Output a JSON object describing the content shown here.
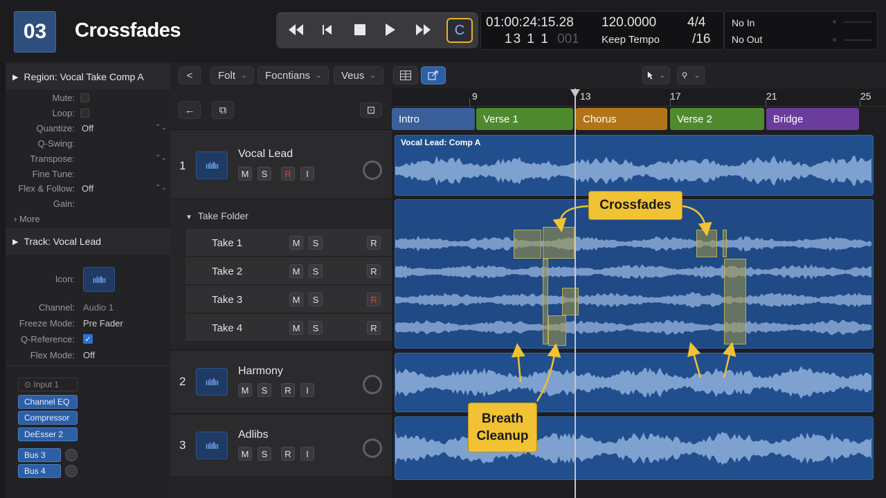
{
  "header": {
    "badge": "03",
    "title": "Crossfades"
  },
  "transport": {
    "rewind_icon": "rewind-icon",
    "back_icon": "skip-back-icon",
    "stop_icon": "stop-icon",
    "play_icon": "play-icon",
    "ffwd_icon": "fast-forward-icon",
    "cycle_label": "C"
  },
  "lcd": {
    "timecode": "01:00:24:15.28",
    "tempo": "120.0000",
    "signature": "4/4",
    "bars": "13 1 1",
    "ticks": "001",
    "tempo_mode": "Keep Tempo",
    "division": "/16",
    "in": "No In",
    "out": "No Out"
  },
  "inspector": {
    "region_header": "Region: Vocal Take Comp A",
    "region_rows": [
      {
        "label": "Mute:",
        "value": ""
      },
      {
        "label": "Loop:",
        "value": ""
      },
      {
        "label": "Quantize:",
        "value": "Off"
      },
      {
        "label": "Q-Swing:",
        "value": ""
      },
      {
        "label": "Transpose:",
        "value": ""
      },
      {
        "label": "Fine Tune:",
        "value": ""
      },
      {
        "label": "Flex & Follow:",
        "value": "Off"
      },
      {
        "label": "Gain:",
        "value": ""
      }
    ],
    "more_label": "More",
    "track_header": "Track:  Vocal Lead",
    "icon_label": "Icon:",
    "track_rows": [
      {
        "label": "Channel:",
        "value": "Audio 1"
      },
      {
        "label": "Freeze Mode:",
        "value": "Pre Fader"
      },
      {
        "label": "Q-Reference:",
        "value": ""
      },
      {
        "label": "Flex Mode:",
        "value": "Off"
      }
    ],
    "input_label": "Input 1",
    "plugins": [
      "Channel EQ",
      "Compressor",
      "DeEsser 2"
    ],
    "sends": [
      "Bus 3",
      "Bus 4"
    ]
  },
  "toolbar": {
    "back_label": "<",
    "menus": [
      "Folt",
      "Focntians",
      "Veus"
    ],
    "pointer_tool": "pointer-icon",
    "second_tool": "pencil-icon"
  },
  "tracks": [
    {
      "num": "1",
      "name": "Vocal Lead",
      "m": "M",
      "s": "S",
      "r": "R",
      "i": "I"
    },
    {
      "num": "2",
      "name": "Harmony",
      "m": "M",
      "s": "S",
      "r": "R",
      "i": "I"
    },
    {
      "num": "3",
      "name": "Adlibs",
      "m": "M",
      "s": "S",
      "r": "R",
      "i": "I"
    }
  ],
  "take_folder": {
    "label": "Take Folder",
    "takes": [
      {
        "name": "Take 1",
        "m": "M",
        "s": "S",
        "r": "R"
      },
      {
        "name": "Take 2",
        "m": "M",
        "s": "S",
        "r": "R"
      },
      {
        "name": "Take 3",
        "m": "M",
        "s": "S",
        "r": "R"
      },
      {
        "name": "Take 4",
        "m": "M",
        "s": "S",
        "r": "R"
      }
    ]
  },
  "ruler": {
    "bars": [
      "9",
      "13",
      "17",
      "21",
      "25"
    ]
  },
  "markers": [
    {
      "name": "Intro",
      "color": "#3a5f9a"
    },
    {
      "name": "Verse 1",
      "color": "#4f8a2e"
    },
    {
      "name": "Chorus",
      "color": "#b27418"
    },
    {
      "name": "Verse 2",
      "color": "#4f8a2e"
    },
    {
      "name": "Bridge",
      "color": "#6a3c9c"
    }
  ],
  "regions": {
    "comp_label": "Vocal Lead: Comp A"
  },
  "callouts": {
    "crossfades": "Crossfades",
    "breath_line1": "Breath",
    "breath_line2": "Cleanup"
  },
  "colors": {
    "accent": "#f1c233",
    "region": "#214f8e",
    "record": "#e0432b"
  }
}
